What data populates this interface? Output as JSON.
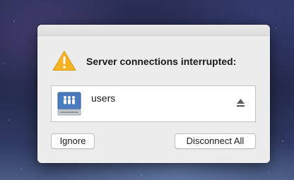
{
  "dialog": {
    "title": "Server connections interrupted:",
    "warning_icon": "warning-triangle-icon",
    "servers": [
      {
        "name": "users",
        "icon": "network-server-icon",
        "action_icon": "eject-icon"
      }
    ],
    "buttons": {
      "ignore": "Ignore",
      "disconnect_all": "Disconnect All"
    }
  },
  "colors": {
    "warning": "#f5b324",
    "server_icon": "#4a7bbf"
  }
}
